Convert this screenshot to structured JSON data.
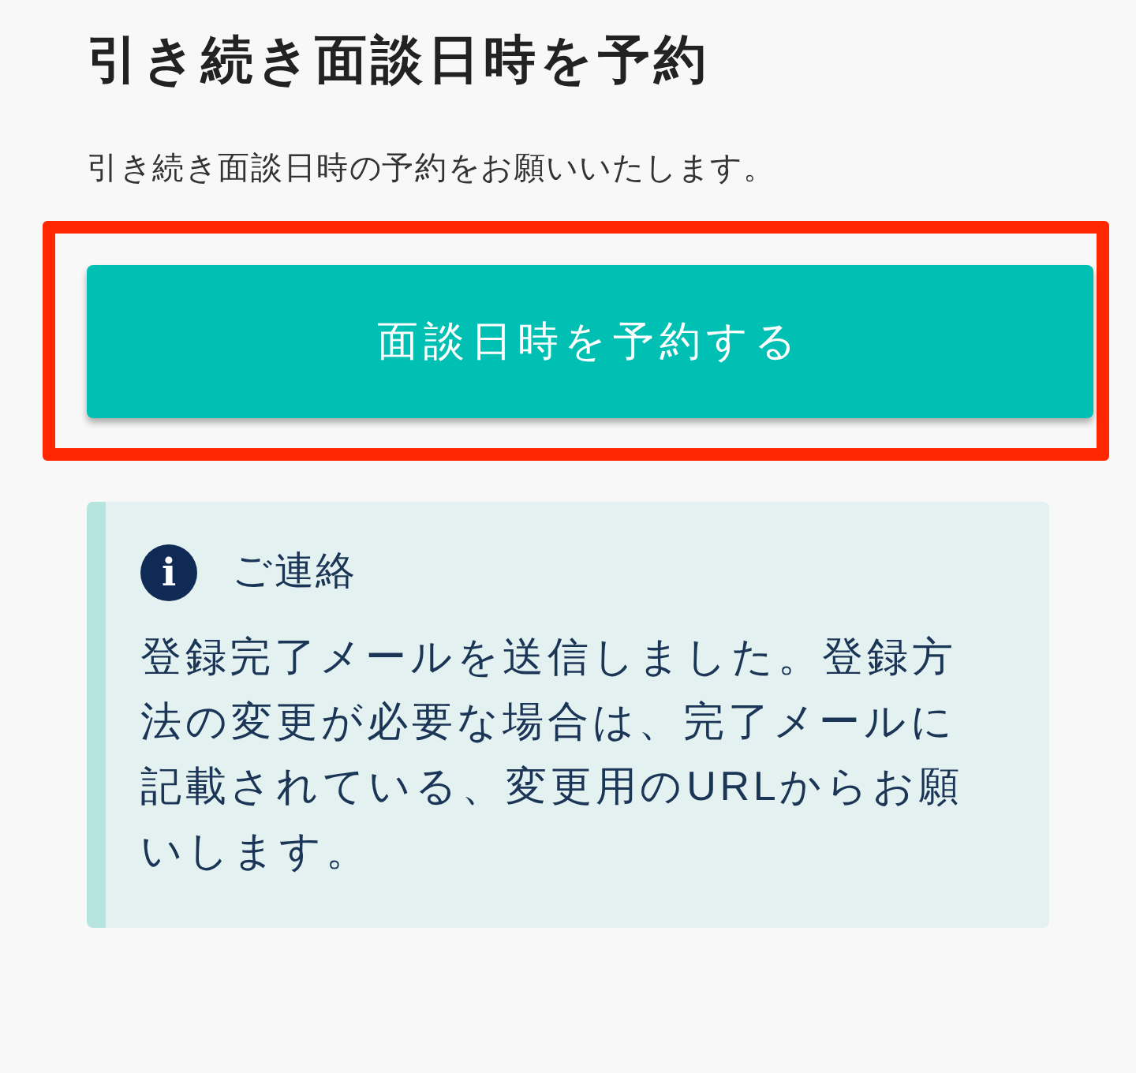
{
  "title": "引き続き面談日時を予約",
  "description": "引き続き面談日時の予約をお願いいたします。",
  "button": {
    "label": "面談日時を予約する",
    "highlighted": true
  },
  "notice": {
    "icon": "i",
    "title": "ご連絡",
    "body": "登録完了メールを送信しました。登録方法の変更が必要な場合は、完了メールに記載されている、変更用のURLからお願いします。"
  }
}
